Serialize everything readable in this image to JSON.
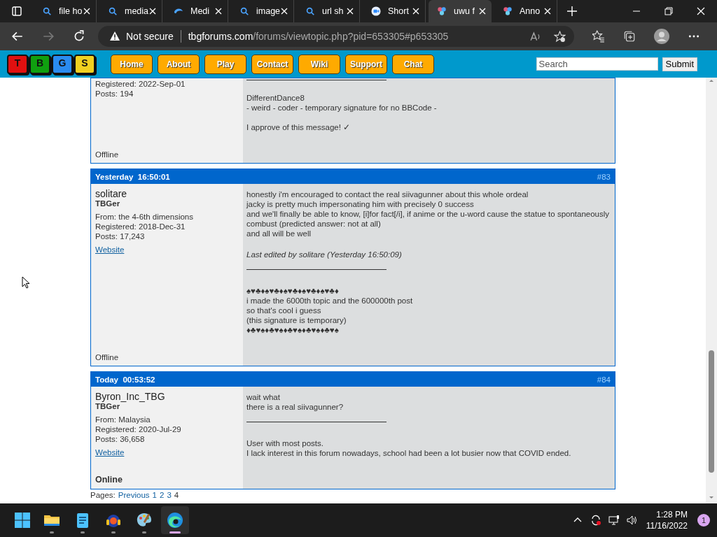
{
  "browser": {
    "tabs": [
      {
        "title": "file ho",
        "kind": "search",
        "selected": false
      },
      {
        "title": "media",
        "kind": "search",
        "selected": false
      },
      {
        "title": "Medi",
        "kind": "edge",
        "selected": false
      },
      {
        "title": "image",
        "kind": "search",
        "selected": false
      },
      {
        "title": "url sh",
        "kind": "search",
        "selected": false
      },
      {
        "title": "Short",
        "kind": "video",
        "selected": false
      },
      {
        "title": "uwu f",
        "kind": "dots",
        "selected": true
      },
      {
        "title": "Anno",
        "kind": "dots",
        "selected": false
      }
    ],
    "address": {
      "warning": "Not secure",
      "host": "tbgforums.com",
      "path": "/forums/viewtopic.php?pid=653305#p653305"
    }
  },
  "site": {
    "logo": [
      {
        "letter": "T",
        "color": "#e01010"
      },
      {
        "letter": "B",
        "color": "#10a010"
      },
      {
        "letter": "G",
        "color": "#2a8cf0"
      },
      {
        "letter": "S",
        "color": "#f0d020"
      }
    ],
    "nav": [
      "Home",
      "About",
      "Play",
      "Contact",
      "Wiki",
      "Support",
      "Chat"
    ],
    "search": {
      "placeholder": "Search",
      "button": "Submit"
    }
  },
  "posts": [
    {
      "registered": "Registered: 2022-Sep-01",
      "posts": "Posts: 194",
      "online": false,
      "status": "Offline",
      "signature": [
        [
          "DifferentDance8",
          "- weird - coder - temporary signature for no BBCode -"
        ],
        [
          "I approve of this message! ✓"
        ]
      ]
    },
    {
      "date": "Yesterday  16:50:01",
      "number": "#83",
      "author": "solitare",
      "title": "TBGer",
      "from": "From: the 4-6th dimensions",
      "registered": "Registered: 2018-Dec-31",
      "posts": "Posts: 17,243",
      "website": "Website",
      "online": false,
      "status": "Offline",
      "message": [
        [
          "honestly i'm encouraged to contact the real siivagunner about this whole ordeal",
          "jacky is pretty much impersonating him with precisely 0 success",
          "and we'll finally be able to know, [i]for fact[/i], if anime or the u-word cause the statue to spontaneously combust (predicted answer: not at all)",
          "and all will be well"
        ]
      ],
      "edited": "Last edited by solitare (Yesterday  16:50:09)",
      "signature": [
        [
          "♠♥♣♦♠♥♣♦♠♥♣♦♠♥♣♦♠♥♣♦",
          "i made the 6000th topic and the 600000th post",
          "so that's cool i guess",
          "(this signature is temporary)",
          "♦♣♥♠♦♣♥♠♦♣♥♠♦♣♥♠♦♣♥♠"
        ]
      ]
    },
    {
      "date": "Today  00:53:52",
      "number": "#84",
      "author": "Byron_Inc_TBG",
      "title": "TBGer",
      "from": "From: Malaysia",
      "registered": "Registered: 2020-Jul-29",
      "posts": "Posts: 36,658",
      "website": "Website",
      "online": true,
      "status": "Online",
      "message": [
        [
          "wait what",
          "there is a real siivagunner?"
        ]
      ],
      "signature": [
        [
          "User with most posts.",
          "I lack interest in this forum nowadays, school had been a lot busier now that COVID ended."
        ]
      ]
    }
  ],
  "pagination": {
    "label": "Pages:",
    "links": [
      "Previous",
      "1",
      "2",
      "3"
    ],
    "current": "4"
  },
  "taskbar": {
    "apps": [
      {
        "kind": "explorer",
        "selected": false
      },
      {
        "kind": "notepad",
        "selected": false
      },
      {
        "kind": "media",
        "selected": false
      },
      {
        "kind": "paint",
        "selected": false
      },
      {
        "kind": "edge",
        "selected": true
      }
    ],
    "time": "1:28 PM",
    "date": "11/16/2022",
    "notifications": "1"
  }
}
